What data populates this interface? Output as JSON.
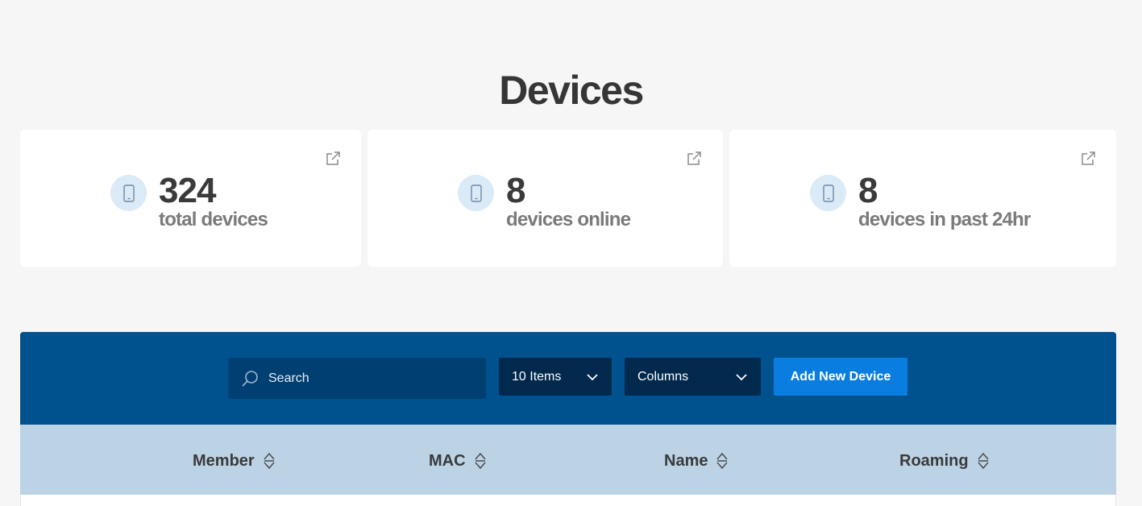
{
  "page": {
    "title": "Devices"
  },
  "stats": [
    {
      "value": "324",
      "label": "total devices"
    },
    {
      "value": "8",
      "label": "devices online"
    },
    {
      "value": "8",
      "label": "devices in past 24hr"
    }
  ],
  "toolbar": {
    "search_placeholder": "Search",
    "items_select": "10 Items",
    "columns_select": "Columns",
    "add_button": "Add New Device"
  },
  "table": {
    "columns": [
      "Member",
      "MAC",
      "Name",
      "Roaming"
    ]
  },
  "icons": {
    "stat_icon": "smartphone-icon",
    "stat_link": "external-link-icon",
    "search": "search-icon",
    "dropdown": "chevron-down-icon",
    "sort": "sort-icon"
  },
  "colors": {
    "toolbar_bg": "#00528f",
    "search_bg": "#003f72",
    "select_bg": "#00294d",
    "primary_button": "#0a7ee0",
    "table_header_bg": "#bcd3e6",
    "icon_circle": "#dbeaf7"
  }
}
